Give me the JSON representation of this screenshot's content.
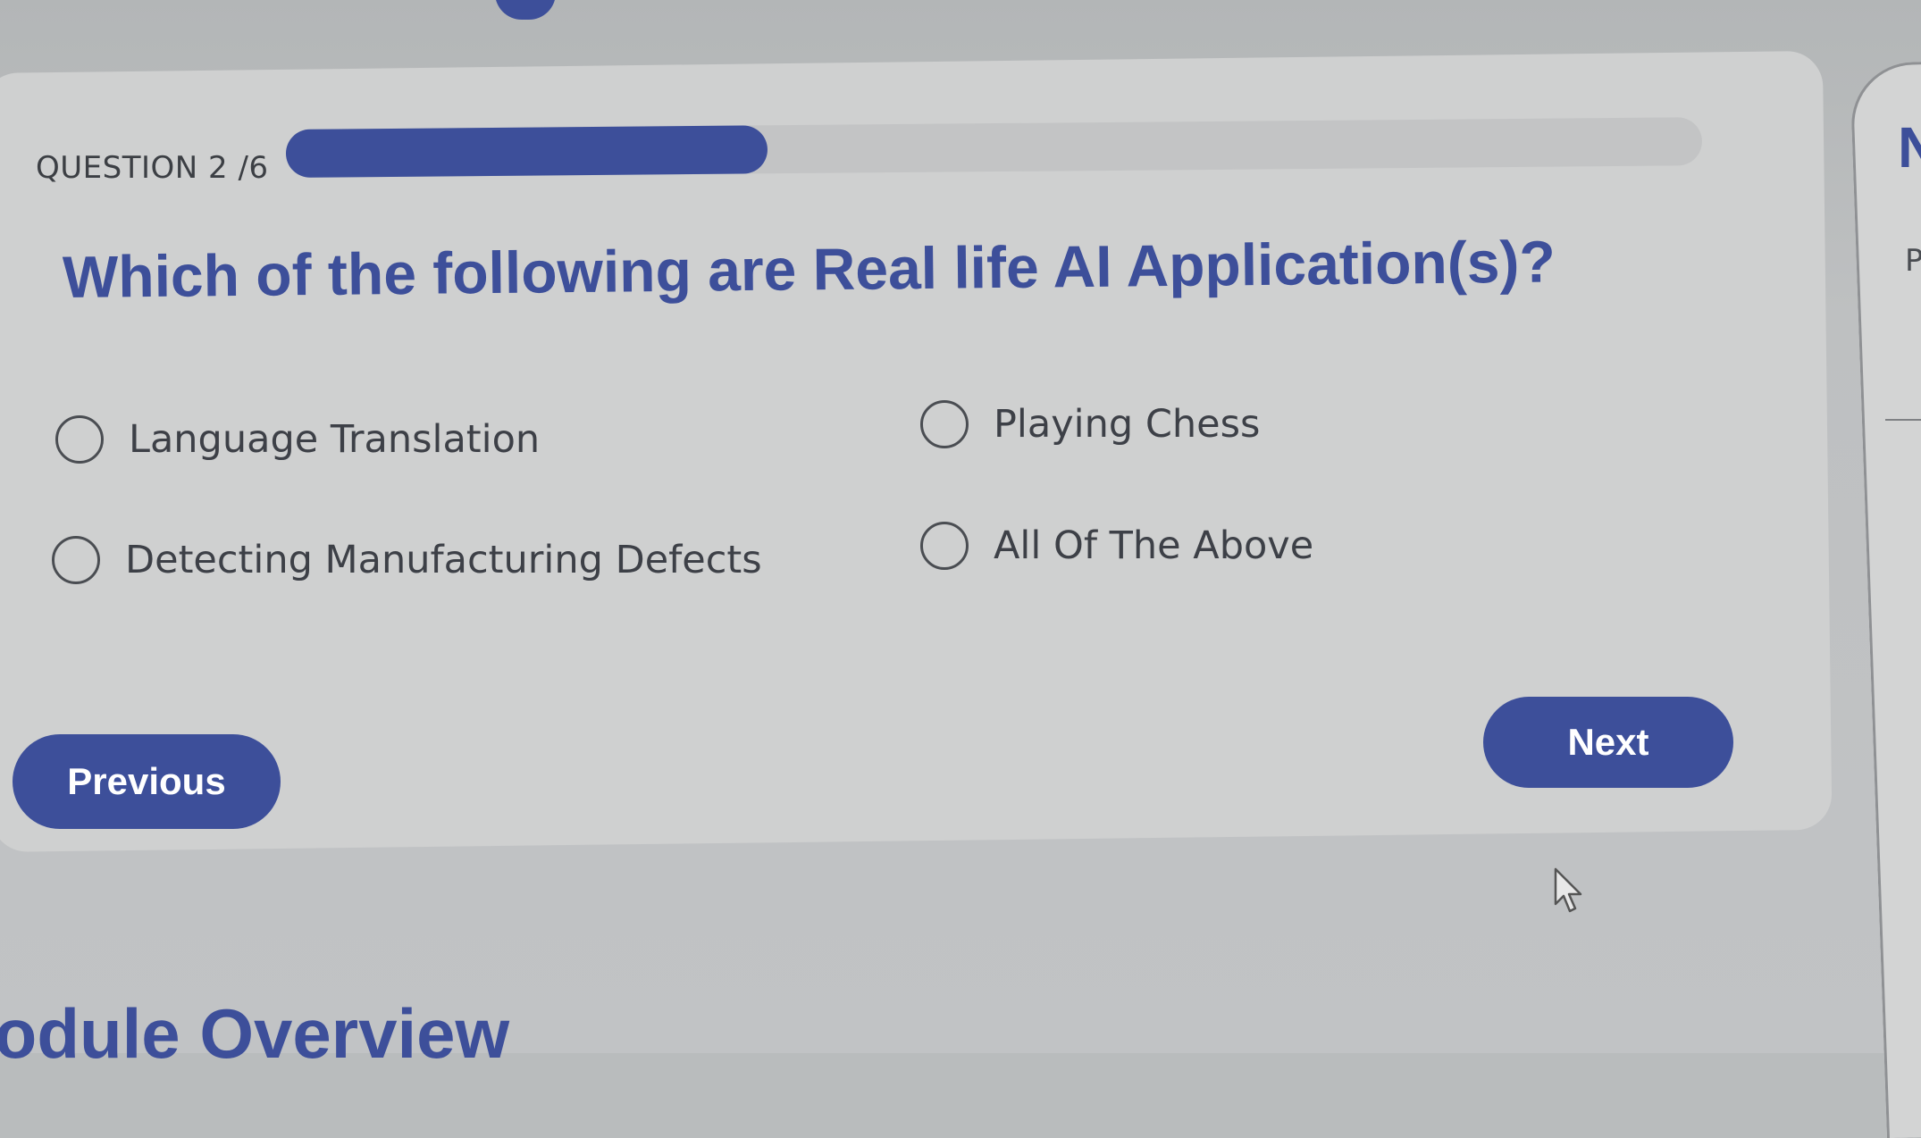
{
  "quiz": {
    "question_counter": "QUESTION 2 /6",
    "progress_fraction": 0.34,
    "question": "Which of the following are Real life AI Application(s)?",
    "options": [
      {
        "label": "Language Translation"
      },
      {
        "label": "Playing Chess"
      },
      {
        "label": "Detecting Manufacturing Defects"
      },
      {
        "label": "All Of The Above"
      }
    ],
    "previous_label": "Previous",
    "next_label": "Next"
  },
  "right_panel": {
    "letter_m": "N",
    "letter_p": "P"
  },
  "section": {
    "title": "lodule Overview"
  },
  "colors": {
    "accent": "#3d4f9a",
    "card": "#cfd0d0",
    "text": "#3d4047"
  },
  "icons": {
    "cursor": "mouse-pointer-icon"
  }
}
